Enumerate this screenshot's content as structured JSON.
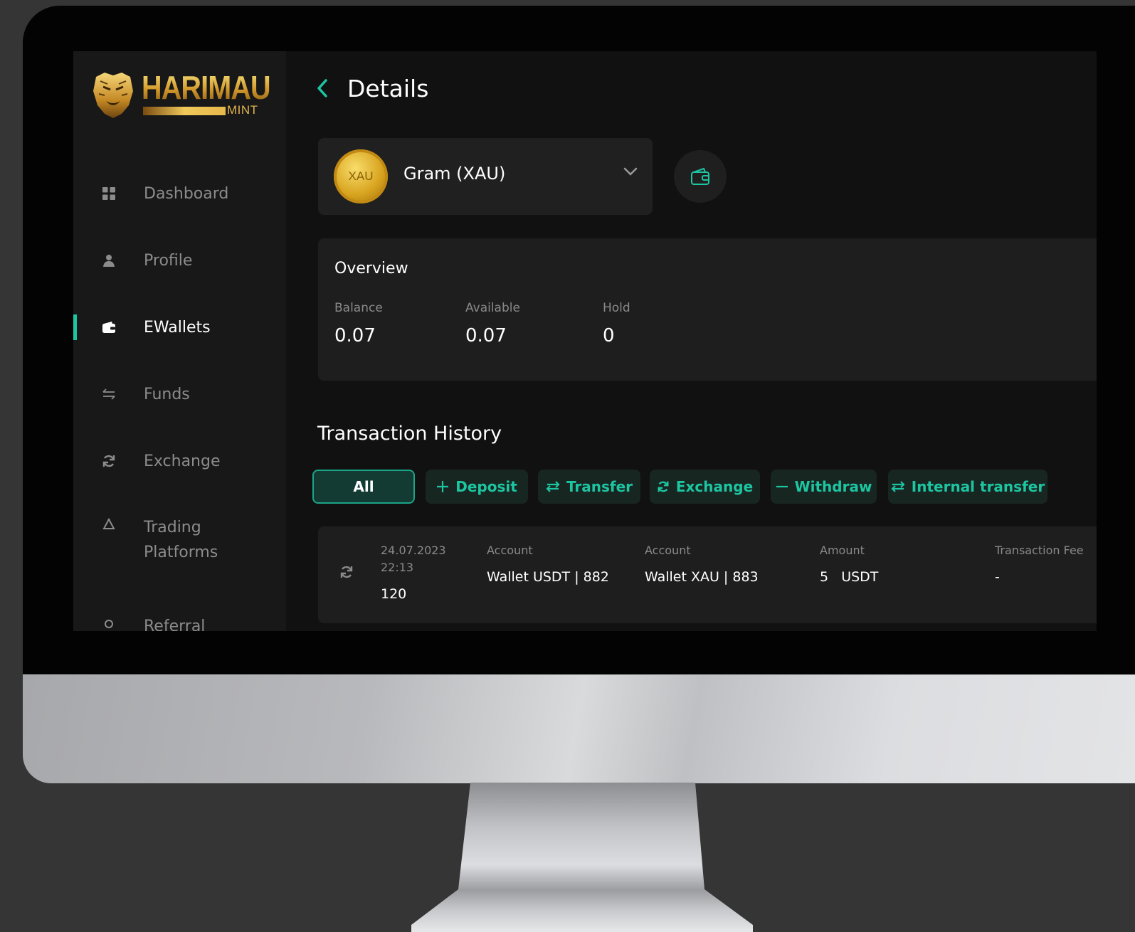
{
  "brand": {
    "name": "HARIMAU",
    "sub": "MINT"
  },
  "sidebar": {
    "items": [
      {
        "label": "Dashboard",
        "icon": "grid-icon"
      },
      {
        "label": "Profile",
        "icon": "user-icon"
      },
      {
        "label": "EWallets",
        "icon": "wallet-icon",
        "active": true
      },
      {
        "label": "Funds",
        "icon": "arrows-icon"
      },
      {
        "label": "Exchange",
        "icon": "refresh-icon"
      },
      {
        "label": "Trading Platforms",
        "icon": "recycle-icon"
      },
      {
        "label": "Referral",
        "icon": "referral-icon"
      }
    ]
  },
  "header": {
    "title": "Details"
  },
  "wallet": {
    "coin_label": "XAU",
    "name": "Gram (XAU)"
  },
  "overview": {
    "title": "Overview",
    "balance_label": "Balance",
    "balance": "0.07",
    "available_label": "Available",
    "available": "0.07",
    "hold_label": "Hold",
    "hold": "0"
  },
  "history": {
    "title": "Transaction History",
    "filters": [
      "All",
      "Deposit",
      "Transfer",
      "Exchange",
      "Withdraw",
      "Internal transfer"
    ],
    "active_filter": "All"
  },
  "transaction": {
    "date": "24.07.2023",
    "time": "22:13",
    "id": "120",
    "from_label": "Account",
    "from": "Wallet USDT | 882",
    "to_label": "Account",
    "to": "Wallet XAU | 883",
    "amount_label": "Amount",
    "amount": "5   USDT",
    "fee_label": "Transaction Fee",
    "fee": "-"
  },
  "colors": {
    "accent": "#1cc6a1",
    "background": "#111111",
    "sidebar": "#181818",
    "card": "#1e1e1e",
    "gold": "#d6a63a"
  }
}
